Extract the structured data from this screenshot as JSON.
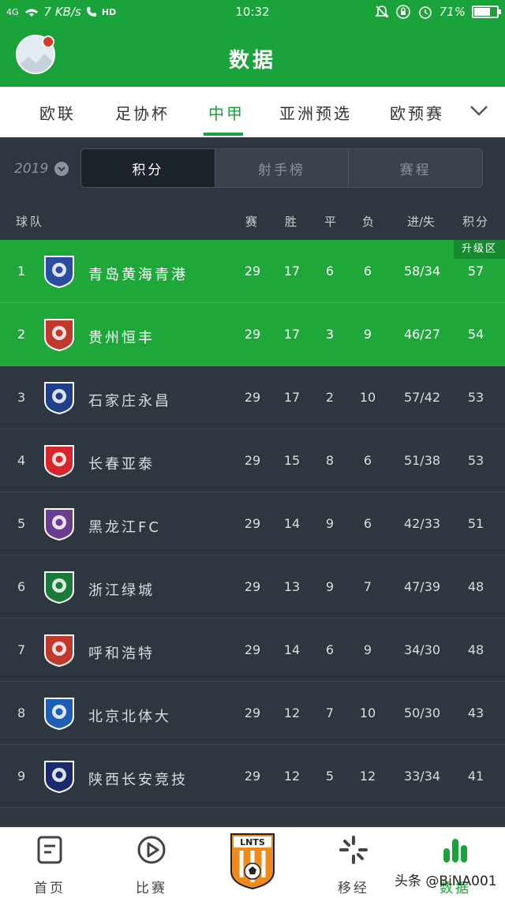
{
  "status_bar": {
    "network": "4G",
    "speed": "7 KB/s",
    "hd": "HD",
    "time": "10:32",
    "battery": "71%",
    "battery_level": 0.71
  },
  "header": {
    "title": "数据"
  },
  "league_tabs": {
    "items": [
      "欧联",
      "足协杯",
      "中甲",
      "亚洲预选",
      "欧预赛"
    ],
    "active": "中甲"
  },
  "filter": {
    "year": "2019",
    "segments": [
      "积分",
      "射手榜",
      "赛程"
    ],
    "active_segment": "积分"
  },
  "table": {
    "columns": {
      "team": "球队",
      "played": "赛",
      "won": "胜",
      "drawn": "平",
      "lost": "负",
      "goals": "进/失",
      "points": "积分"
    },
    "promotion_label": "升级区",
    "rows": [
      {
        "rank": "1",
        "team": "青岛黄海青港",
        "played": "29",
        "won": "17",
        "drawn": "6",
        "lost": "6",
        "goals": "58/34",
        "points": "57",
        "zone": "promotion",
        "badge_color": "#2a4da0"
      },
      {
        "rank": "2",
        "team": "贵州恒丰",
        "played": "29",
        "won": "17",
        "drawn": "3",
        "lost": "9",
        "goals": "46/27",
        "points": "54",
        "zone": "promotion",
        "badge_color": "#c0392b"
      },
      {
        "rank": "3",
        "team": "石家庄永昌",
        "played": "29",
        "won": "17",
        "drawn": "2",
        "lost": "10",
        "goals": "57/42",
        "points": "53",
        "zone": "",
        "badge_color": "#1f3f8a"
      },
      {
        "rank": "4",
        "team": "长春亚泰",
        "played": "29",
        "won": "15",
        "drawn": "8",
        "lost": "6",
        "goals": "51/38",
        "points": "53",
        "zone": "",
        "badge_color": "#d6252b"
      },
      {
        "rank": "5",
        "team": "黑龙江FC",
        "played": "29",
        "won": "14",
        "drawn": "9",
        "lost": "6",
        "goals": "42/33",
        "points": "51",
        "zone": "",
        "badge_color": "#6a3d8f"
      },
      {
        "rank": "6",
        "team": "浙江绿城",
        "played": "29",
        "won": "13",
        "drawn": "9",
        "lost": "7",
        "goals": "47/39",
        "points": "48",
        "zone": "",
        "badge_color": "#1a7a3a"
      },
      {
        "rank": "7",
        "team": "呼和浩特",
        "played": "29",
        "won": "14",
        "drawn": "6",
        "lost": "9",
        "goals": "34/30",
        "points": "48",
        "zone": "",
        "badge_color": "#c0392b"
      },
      {
        "rank": "8",
        "team": "北京北体大",
        "played": "29",
        "won": "12",
        "drawn": "7",
        "lost": "10",
        "goals": "50/30",
        "points": "43",
        "zone": "",
        "badge_color": "#1e5fb5"
      },
      {
        "rank": "9",
        "team": "陕西长安竞技",
        "played": "29",
        "won": "12",
        "drawn": "5",
        "lost": "12",
        "goals": "33/34",
        "points": "41",
        "zone": "",
        "badge_color": "#1b2a6b"
      }
    ]
  },
  "bottom_nav": {
    "items": [
      {
        "label": "首页",
        "icon": "document-icon"
      },
      {
        "label": "比赛",
        "icon": "play-icon"
      },
      {
        "label": "",
        "icon": "club-logo-icon"
      },
      {
        "label": "移经",
        "icon": "spinner-icon"
      },
      {
        "label": "数据",
        "icon": "bar-chart-icon",
        "active": true
      }
    ],
    "center_logo_text": "LNTS"
  },
  "watermark": "头条 @BiNA001",
  "colors": {
    "brand_green": "#1aa33a",
    "dark_bg": "#2e3640"
  }
}
